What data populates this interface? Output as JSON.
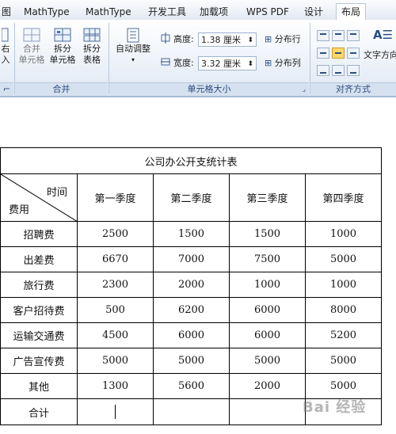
{
  "tabs": [
    "图",
    "MathType",
    "MathType",
    "开发工具",
    "加载项",
    "WPS PDF",
    "设计",
    "布局"
  ],
  "ribbon": {
    "insert_partial": "右\n入",
    "merge_cells": "合并\n单元格",
    "split_cells": "拆分\n单元格",
    "split_table": "拆分\n表格",
    "autofit": "自动调整",
    "height_label": "高度:",
    "height_value": "1.38 厘米",
    "width_label": "宽度:",
    "width_value": "3.32 厘米",
    "distribute_rows": "分布行",
    "distribute_cols": "分布列",
    "text_direction": "文字方向",
    "group_merge": "合并",
    "group_cellsize": "单元格大小",
    "group_alignment": "对齐方式"
  },
  "table": {
    "title": "公司办公开支统计表",
    "diag_top": "时间",
    "diag_bottom": "费用",
    "headers": [
      "第一季度",
      "第二季度",
      "第三季度",
      "第四季度"
    ],
    "rows": [
      {
        "label": "招聘费",
        "values": [
          "2500",
          "1500",
          "1500",
          "1000"
        ]
      },
      {
        "label": "出差费",
        "values": [
          "6670",
          "7000",
          "7500",
          "5000"
        ]
      },
      {
        "label": "旅行费",
        "values": [
          "2300",
          "2000",
          "1000",
          "1000"
        ]
      },
      {
        "label": "客户招待费",
        "values": [
          "500",
          "6200",
          "6000",
          "8000"
        ]
      },
      {
        "label": "运输交通费",
        "values": [
          "4500",
          "6000",
          "6000",
          "5200"
        ]
      },
      {
        "label": "广告宣传费",
        "values": [
          "5000",
          "5000",
          "5000",
          "5000"
        ]
      },
      {
        "label": "其他",
        "values": [
          "1300",
          "5600",
          "2000",
          "5000"
        ]
      }
    ],
    "total_label": "合计"
  },
  "watermark": "Bai 经验"
}
